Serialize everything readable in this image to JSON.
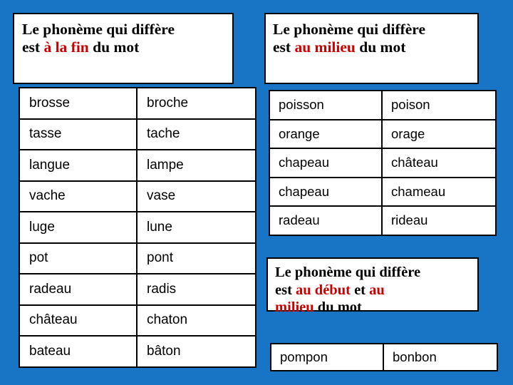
{
  "slide": {
    "background_color": "#1874c4",
    "text_color": "#000000",
    "highlight_color": "#cc0000",
    "panel_background": "#ffffff",
    "border_color": "#000000"
  },
  "left_section": {
    "title": {
      "line1": "Le phonème qui diffère",
      "line2_prefix": "est ",
      "line2_highlight": "à la fin",
      "line2_suffix": " du mot"
    },
    "table": {
      "rows": [
        {
          "col1": "brosse",
          "col2": "broche"
        },
        {
          "col1": "tasse",
          "col2": "tache"
        },
        {
          "col1": "langue",
          "col2": "lampe"
        },
        {
          "col1": "vache",
          "col2": "vase"
        },
        {
          "col1": "luge",
          "col2": "lune"
        },
        {
          "col1": "pot",
          "col2": "pont"
        },
        {
          "col1": "radeau",
          "col2": "radis"
        },
        {
          "col1": "château",
          "col2": "chaton"
        },
        {
          "col1": "bateau",
          "col2": "bâton"
        }
      ]
    }
  },
  "right_section": {
    "title": {
      "line1": "Le phonème qui diffère",
      "line2_prefix": "est ",
      "line2_highlight": "au milieu",
      "line2_suffix": " du mot"
    },
    "table": {
      "rows": [
        {
          "col1": "poisson",
          "col2": "poison"
        },
        {
          "col1": "orange",
          "col2": "orage"
        },
        {
          "col1": "chapeau",
          "col2": "château"
        },
        {
          "col1": "chapeau",
          "col2": "chameau"
        },
        {
          "col1": "radeau",
          "col2": "rideau"
        }
      ]
    }
  },
  "bottom_section": {
    "title": {
      "line1": "Le phonème qui diffère",
      "line2_prefix": "est ",
      "line2_highlight1": "au début",
      "line2_middle": " et ",
      "line2_highlight2": "au",
      "line3_highlight": "milieu",
      "line3_suffix": " du mot"
    },
    "table": {
      "rows": [
        {
          "col1": "pompon",
          "col2": "bonbon"
        }
      ]
    }
  }
}
